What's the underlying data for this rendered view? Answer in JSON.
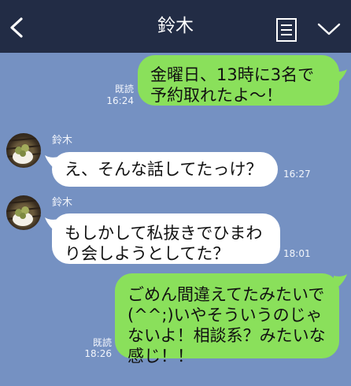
{
  "header": {
    "title": "鈴木",
    "back_icon": "chevron-left-icon",
    "memo_icon": "memo-icon",
    "menu_icon": "chevron-down-icon",
    "background": "#222c45"
  },
  "chat": {
    "background": "#7591c2",
    "messages": [
      {
        "side": "right",
        "text": "金曜日、13時に3名で予約取れたよ〜！",
        "read": "既読",
        "time": "16:24"
      },
      {
        "side": "left",
        "sender": "鈴木",
        "text": "え、そんな話してたっけ？",
        "time": "16:27"
      },
      {
        "side": "left",
        "sender": "鈴木",
        "text": "もしかして私抜きでひまわり会しようとしてた？",
        "time": "18:01"
      },
      {
        "side": "right",
        "text": "ごめん間違えてたみたいで(^^;)いやそういうのじゃないよ！相談系？みたいな感じ！！",
        "read": "既読",
        "time": "18:26"
      }
    ]
  },
  "colors": {
    "outgoing_bubble": "#8ae05b",
    "incoming_bubble": "#ffffff"
  }
}
